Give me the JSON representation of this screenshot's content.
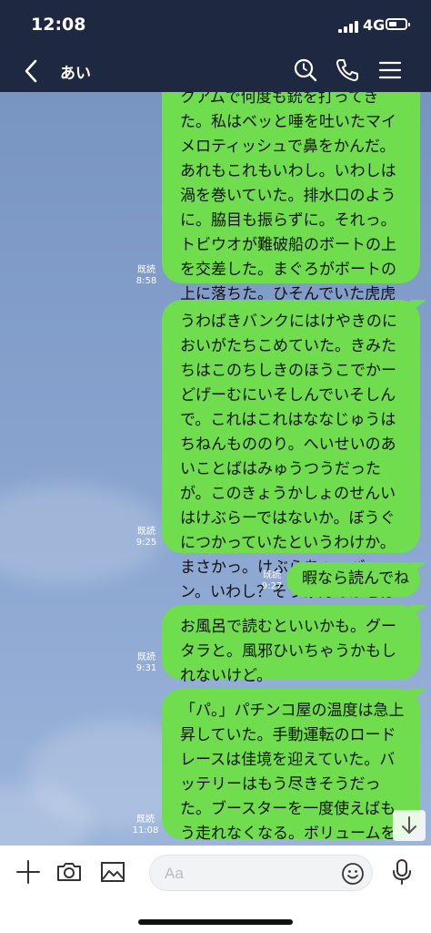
{
  "status": {
    "time": "12:08",
    "network": "4G"
  },
  "header": {
    "title": "あい"
  },
  "messages": [
    {
      "text": "クアムで何度も銃を打ってきた。私はベッと唾を吐いたマイメロティッシュで鼻をかんだ。あれもこれもいわし。いわしは渦を巻いていた。排水口のように。脇目も振らずに。それっ。トビウオが難破船のボートの上を交差した。まぐろがボートの上に落ちた。ひそんでいた虎虎虎。虎退治に寺寺寺。寺から来た。",
      "read": "既読",
      "time": "8:58"
    },
    {
      "text": "うわばきバンクにはけやきのにおいがたちこめていた。きみたちはこのちしきのほうこでかーどげーむにいそしんでいそしんで。これはこれはななじゅうはちねんもののり。へいせいのあいことばはみゅうつうだったが。このきょうかしょのせんいはけぶらーではないか。ぼうぐにつかっていたというわけか。まさかっ。けぶらあぁ。バーン。いわし？そうげんのかぜはゆらいでいた。",
      "read": "既読",
      "time": "9:25"
    },
    {
      "text": "暇なら読んでね",
      "read": "既読",
      "time": "9:27"
    },
    {
      "text": "お風呂で読むといいかも。グータラと。風邪ひいちゃうかもしれないけど。",
      "read": "既読",
      "time": "9:31"
    },
    {
      "text": "「パ。」パチンコ屋の温度は急上昇していた。手動運転のロードレースは佳境を迎えていた。バッテリーはもう尽きそうだった。ブースターを一度使えばもう走れなくなる。ボリュームを下げるしかなかった。",
      "read": "既読",
      "time": "11:08"
    }
  ],
  "input": {
    "placeholder": "Aa"
  },
  "colors": {
    "header": "#1f2841",
    "bubble": "#6fdd4e",
    "chat_bg": "#819dc9"
  },
  "icons": [
    "back-icon",
    "search-icon",
    "phone-icon",
    "menu-icon",
    "scroll-down-icon",
    "plus-icon",
    "camera-icon",
    "image-icon",
    "emoji-icon",
    "microphone-icon"
  ]
}
